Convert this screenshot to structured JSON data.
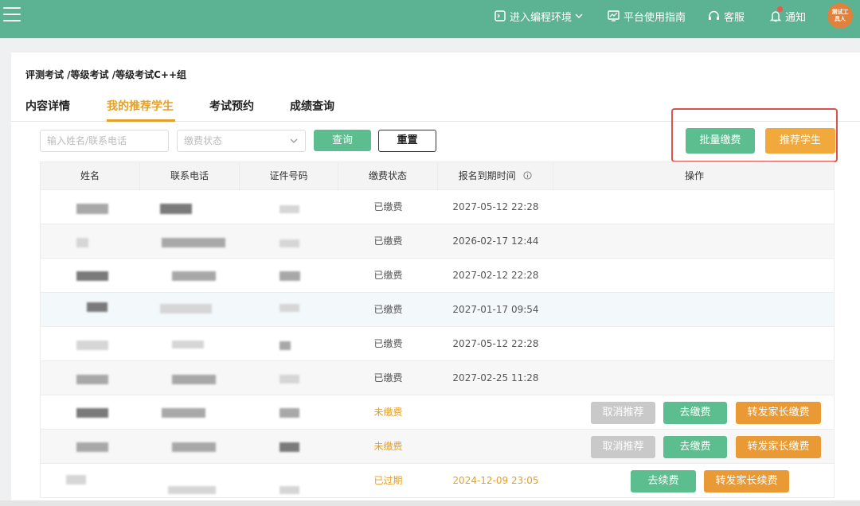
{
  "topbar": {
    "menu_icon": "hamburger-icon",
    "coding_env": "进入编程环境",
    "guide": "平台使用指南",
    "service": "客服",
    "notify": "通知",
    "avatar_text": "测试工具人",
    "bg_color": "#5bb394"
  },
  "breadcrumb": "评测考试 /等级考试 /等级考试C++组",
  "tabs": [
    {
      "label": "内容详情"
    },
    {
      "label": "我的推荐学生"
    },
    {
      "label": "考试预约"
    },
    {
      "label": "成绩查询"
    }
  ],
  "filters": {
    "name_placeholder": "输入姓名/联系电话",
    "status_placeholder": "缴费状态",
    "query": "查询",
    "reset": "重置"
  },
  "actions": {
    "batch_pay": "批量缴费",
    "recommend": "推荐学生"
  },
  "table": {
    "headers": [
      "姓名",
      "联系电话",
      "证件号码",
      "缴费状态",
      "报名到期时间",
      "操作"
    ],
    "rows": [
      {
        "status": "已缴费",
        "expire": "2027-05-12 22:28"
      },
      {
        "status": "已缴费",
        "expire": "2026-02-17 12:44"
      },
      {
        "status": "已缴费",
        "expire": "2027-02-12 22:28"
      },
      {
        "status": "已缴费",
        "expire": "2027-01-17 09:54"
      },
      {
        "status": "已缴费",
        "expire": "2027-05-12 22:28"
      },
      {
        "status": "已缴费",
        "expire": "2027-02-25 11:28"
      },
      {
        "status": "未缴费",
        "expire": "",
        "btn1": "取消推荐",
        "btn2": "去缴费",
        "btn3": "转发家长缴费"
      },
      {
        "status": "未缴费",
        "expire": "",
        "btn1": "取消推荐",
        "btn2": "去缴费",
        "btn3": "转发家长缴费"
      },
      {
        "status": "已过期",
        "expire": "2024-12-09 23:05",
        "btn2": "去续费",
        "btn3": "转发家长续费"
      }
    ]
  },
  "colors": {
    "accent_orange": "#e3a02a",
    "green": "#5cbd8e",
    "highlight_red": "#d9534f"
  }
}
